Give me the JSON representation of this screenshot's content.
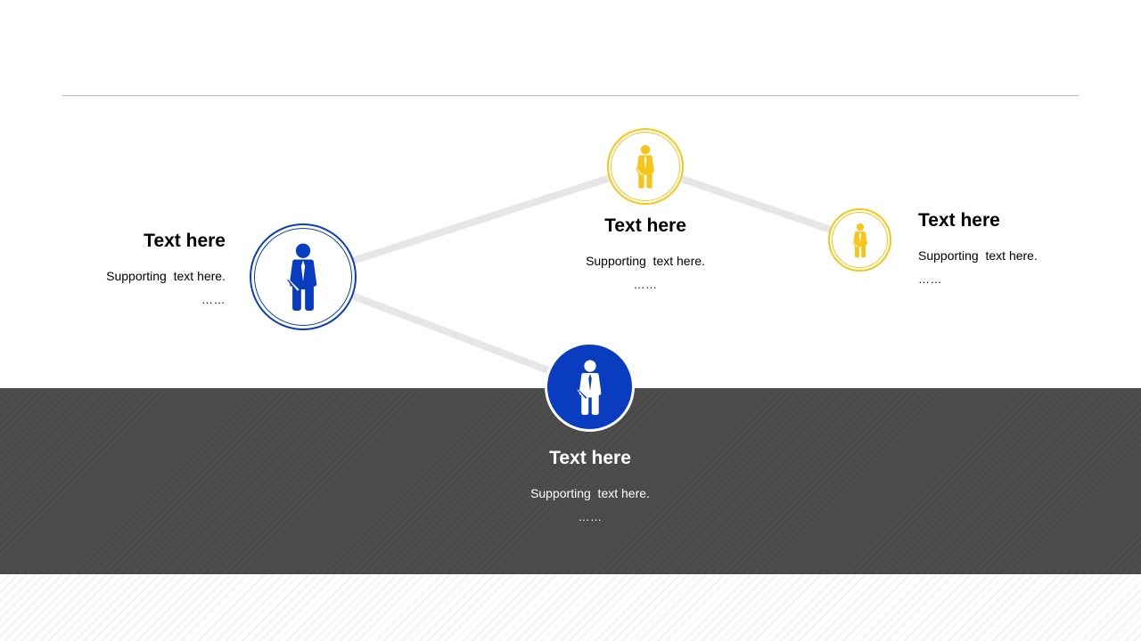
{
  "colors": {
    "blue": "#0a3cbf",
    "yellow": "#f5c518",
    "dark_band": "#4a4a4a",
    "connector": "#e6e6e6"
  },
  "icon": "person-with-tie-icon",
  "nodes": [
    {
      "title": "Text here",
      "supporting": "Supporting  text here.",
      "ellipsis": "……",
      "color": "#0a3cbf",
      "style": "outline"
    },
    {
      "title": "Text here",
      "supporting": "Supporting  text here.",
      "ellipsis": "……",
      "color": "#0a3cbf",
      "style": "filled"
    },
    {
      "title": "Text here",
      "supporting": "Supporting  text here.",
      "ellipsis": "……",
      "color": "#f5c518",
      "style": "outline"
    },
    {
      "title": "Text here",
      "supporting": "Supporting  text here.",
      "ellipsis": "……",
      "color": "#f5c518",
      "style": "outline"
    }
  ]
}
